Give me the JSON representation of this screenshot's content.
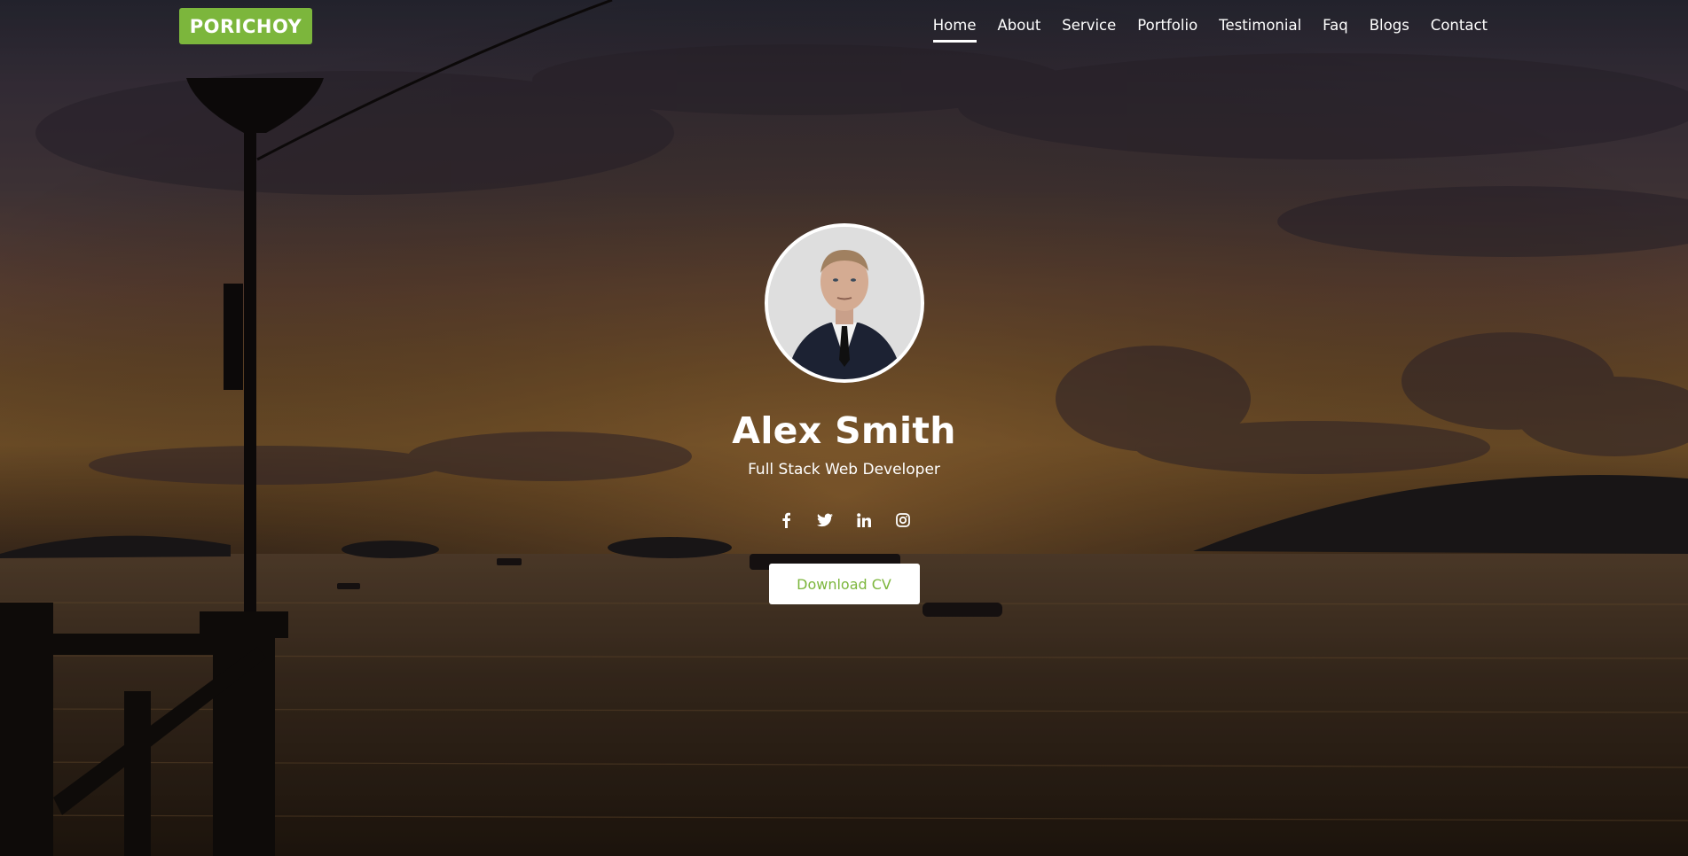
{
  "brand": {
    "logo_text": "PORICHOY",
    "accent_color": "#7cb63c"
  },
  "nav": {
    "items": [
      {
        "label": "Home",
        "active": true
      },
      {
        "label": "About"
      },
      {
        "label": "Service"
      },
      {
        "label": "Portfolio"
      },
      {
        "label": "Testimonial"
      },
      {
        "label": "Faq"
      },
      {
        "label": "Blogs"
      },
      {
        "label": "Contact"
      }
    ]
  },
  "profile": {
    "name": "Alex Smith",
    "role": "Full Stack Web Developer",
    "avatar_icon": "person-portrait"
  },
  "socials": [
    {
      "icon": "facebook-icon"
    },
    {
      "icon": "twitter-icon"
    },
    {
      "icon": "linkedin-icon"
    },
    {
      "icon": "instagram-icon"
    }
  ],
  "cta": {
    "download_label": "Download CV"
  }
}
